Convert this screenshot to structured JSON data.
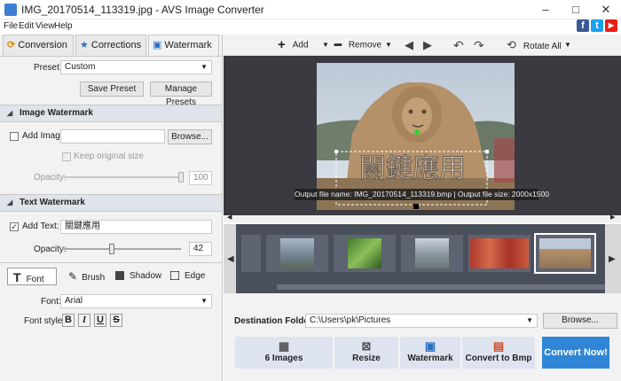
{
  "window": {
    "title": "IMG_20170514_113319.jpg - AVS Image Converter",
    "controls": [
      "–",
      "□",
      "✕"
    ]
  },
  "menu": [
    "File",
    "Edit",
    "View",
    "Help"
  ],
  "social": [
    "f",
    "t",
    "▶"
  ],
  "tabs": [
    {
      "label": "Conversion",
      "icon": "refresh-icon"
    },
    {
      "label": "Corrections",
      "icon": "star-icon"
    },
    {
      "label": "Watermark",
      "icon": "watermark-icon",
      "active": true
    }
  ],
  "preset": {
    "label": "Preset:",
    "value": "Custom",
    "save": "Save Preset",
    "manage": "Manage Presets"
  },
  "image_watermark": {
    "header": "Image Watermark",
    "add_image_label": "Add Image:",
    "add_image_checked": false,
    "path": "",
    "browse": "Browse...",
    "keep_original": "Keep original size",
    "opacity_label": "Opacity:",
    "opacity": "100",
    "opacity_fraction": 1.0
  },
  "text_watermark": {
    "header": "Text Watermark",
    "add_text_label": "Add Text:",
    "add_text_checked": true,
    "text": "關鍵應用",
    "opacity_label": "Opacity:",
    "opacity": "42",
    "opacity_fraction": 0.42
  },
  "text_tools": {
    "font": "Font",
    "brush": "Brush",
    "shadow": "Shadow",
    "edge": "Edge"
  },
  "font": {
    "label": "Font:",
    "value": "Arial",
    "style_label": "Font style:",
    "styles": [
      "B",
      "I",
      "U",
      "S"
    ]
  },
  "toolbar": {
    "add": "Add",
    "remove": "Remove",
    "rotate_all": "Rotate All"
  },
  "preview": {
    "watermark_text": "關鍵應用",
    "file_info": "Output file name: IMG_20170514_113319.bmp | Output file size: 2000x1500"
  },
  "destination": {
    "label": "Destination Folder:",
    "path": "C:\\Users\\pk\\Pictures",
    "browse": "Browse..."
  },
  "steps": [
    {
      "label": "6 Images",
      "icon": "images-icon"
    },
    {
      "label": "Resize",
      "icon": "resize-icon"
    },
    {
      "label": "Watermark",
      "icon": "watermark-icon"
    },
    {
      "label": "Convert to Bmp",
      "icon": "bmp-icon"
    }
  ],
  "convert_button": "Convert Now!",
  "colors": {
    "accent": "#2f86d6",
    "section": "#dfe4ea",
    "preview_bg": "#3a3a40"
  }
}
